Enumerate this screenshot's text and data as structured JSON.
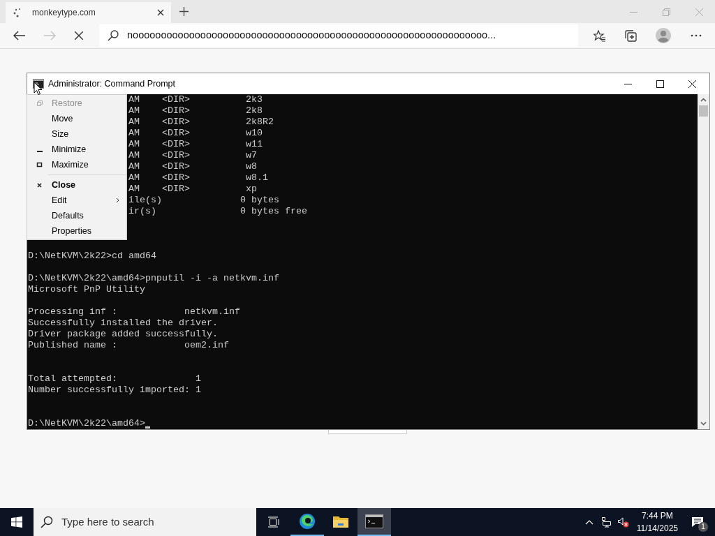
{
  "browser": {
    "tab": {
      "title": "monkeytype.com",
      "loading": true
    },
    "address": "nooooooooooooooooooooooooooooooooooooooooooooooooooooooooooooooo...",
    "forward_disabled": true
  },
  "console": {
    "title": "Administrator: Command Prompt",
    "lines": [
      {
        "kind": "clipped",
        "text": "AM    <DIR>          2k3"
      },
      {
        "kind": "clipped",
        "text": "AM    <DIR>          2k8"
      },
      {
        "kind": "clipped",
        "text": "AM    <DIR>          2k8R2"
      },
      {
        "kind": "clipped",
        "text": "AM    <DIR>          w10"
      },
      {
        "kind": "clipped",
        "text": "AM    <DIR>          w11"
      },
      {
        "kind": "clipped",
        "text": "AM    <DIR>          w7"
      },
      {
        "kind": "clipped",
        "text": "AM    <DIR>          w8"
      },
      {
        "kind": "clipped",
        "text": "AM    <DIR>          w8.1"
      },
      {
        "kind": "clipped",
        "text": "AM    <DIR>          xp"
      },
      {
        "kind": "clipped",
        "text": "ile(s)              0 bytes"
      },
      {
        "kind": "clipped",
        "text": "ir(s)               0 bytes free"
      },
      {
        "kind": "blank"
      },
      {
        "kind": "blank"
      },
      {
        "kind": "blank"
      },
      {
        "kind": "line",
        "text": "D:\\NetKVM\\2k22>cd amd64"
      },
      {
        "kind": "blank"
      },
      {
        "kind": "line",
        "text": "D:\\NetKVM\\2k22\\amd64>pnputil -i -a netkvm.inf"
      },
      {
        "kind": "line",
        "text": "Microsoft PnP Utility"
      },
      {
        "kind": "blank"
      },
      {
        "kind": "line",
        "text": "Processing inf :            netkvm.inf"
      },
      {
        "kind": "line",
        "text": "Successfully installed the driver."
      },
      {
        "kind": "line",
        "text": "Driver package added successfully."
      },
      {
        "kind": "line",
        "text": "Published name :            oem2.inf"
      },
      {
        "kind": "blank"
      },
      {
        "kind": "blank"
      },
      {
        "kind": "line",
        "text": "Total attempted:              1"
      },
      {
        "kind": "line",
        "text": "Number successfully imported: 1"
      },
      {
        "kind": "blank"
      },
      {
        "kind": "blank"
      },
      {
        "kind": "prompt",
        "text": "D:\\NetKVM\\2k22\\amd64>",
        "cursor": true
      }
    ],
    "menu": [
      {
        "kind": "restore",
        "label": "Restore",
        "disabled": true
      },
      {
        "kind": "item",
        "label": "Move",
        "disabled": false
      },
      {
        "kind": "item",
        "label": "Size",
        "disabled": false
      },
      {
        "kind": "minimize",
        "label": "Minimize",
        "disabled": false
      },
      {
        "kind": "maximize",
        "label": "Maximize",
        "disabled": false
      },
      {
        "kind": "separator"
      },
      {
        "kind": "close",
        "label": "Close",
        "bold": true,
        "disabled": false
      },
      {
        "kind": "item",
        "label": "Edit",
        "submenu": true,
        "disabled": false
      },
      {
        "kind": "item",
        "label": "Defaults",
        "disabled": false
      },
      {
        "kind": "item",
        "label": "Properties",
        "disabled": false
      }
    ]
  },
  "taskbar": {
    "search_placeholder": "Type here to search",
    "apps": [
      {
        "kind": "taskview",
        "selected": false,
        "running": false
      },
      {
        "kind": "edge",
        "selected": false,
        "running": true
      },
      {
        "kind": "explorer",
        "selected": false,
        "running": false
      },
      {
        "kind": "cmd",
        "selected": true,
        "running": true
      }
    ],
    "time": "7:44 PM",
    "date": "11/14/2025",
    "notifications": "1"
  }
}
